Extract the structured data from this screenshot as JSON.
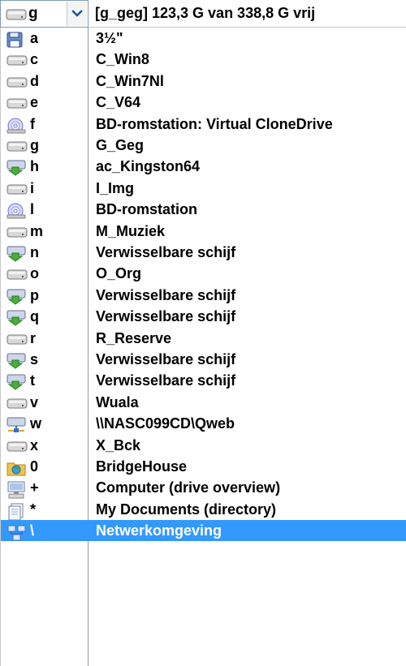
{
  "header": {
    "current_drive_letter": "g",
    "current_drive_icon": "hard-drive-icon",
    "info_text": "[g_geg]  123,3 G van 338,8 G vrij"
  },
  "drives": [
    {
      "letter": "a",
      "label": "3½\"",
      "icon": "floppy-icon"
    },
    {
      "letter": "c",
      "label": "C_Win8",
      "icon": "hard-drive-icon"
    },
    {
      "letter": "d",
      "label": "C_Win7Nl",
      "icon": "hard-drive-icon"
    },
    {
      "letter": "e",
      "label": "C_V64",
      "icon": "hard-drive-icon"
    },
    {
      "letter": "f",
      "label": "BD-romstation: Virtual CloneDrive",
      "icon": "optical-drive-icon"
    },
    {
      "letter": "g",
      "label": "G_Geg",
      "icon": "hard-drive-icon"
    },
    {
      "letter": "h",
      "label": "ac_Kingston64",
      "icon": "removable-drive-icon"
    },
    {
      "letter": "i",
      "label": "I_Img",
      "icon": "hard-drive-icon"
    },
    {
      "letter": "l",
      "label": "BD-romstation",
      "icon": "optical-drive-icon"
    },
    {
      "letter": "m",
      "label": "M_Muziek",
      "icon": "hard-drive-icon"
    },
    {
      "letter": "n",
      "label": "Verwisselbare schijf",
      "icon": "removable-drive-icon"
    },
    {
      "letter": "o",
      "label": "O_Org",
      "icon": "hard-drive-icon"
    },
    {
      "letter": "p",
      "label": "Verwisselbare schijf",
      "icon": "removable-drive-icon"
    },
    {
      "letter": "q",
      "label": "Verwisselbare schijf",
      "icon": "removable-drive-icon"
    },
    {
      "letter": "r",
      "label": "R_Reserve",
      "icon": "hard-drive-icon"
    },
    {
      "letter": "s",
      "label": "Verwisselbare schijf",
      "icon": "removable-drive-icon"
    },
    {
      "letter": "t",
      "label": "Verwisselbare schijf",
      "icon": "removable-drive-icon"
    },
    {
      "letter": "v",
      "label": "Wuala",
      "icon": "hard-drive-icon"
    },
    {
      "letter": "w",
      "label": "\\\\NASC099CD\\Qweb",
      "icon": "network-drive-icon"
    },
    {
      "letter": "x",
      "label": "X_Bck",
      "icon": "hard-drive-icon"
    },
    {
      "letter": "0",
      "label": "BridgeHouse",
      "icon": "folder-globe-icon"
    },
    {
      "letter": "+",
      "label": "Computer (drive overview)",
      "icon": "computer-icon"
    },
    {
      "letter": "*",
      "label": "My Documents (directory)",
      "icon": "documents-icon"
    },
    {
      "letter": "\\",
      "label": "Netwerkomgeving",
      "icon": "network-icon",
      "selected": true
    }
  ],
  "colors": {
    "selection_bg": "#3399ff",
    "selection_fg": "#ffffff",
    "divider": "#9a9a9a",
    "combo_border": "#7f9db9"
  }
}
